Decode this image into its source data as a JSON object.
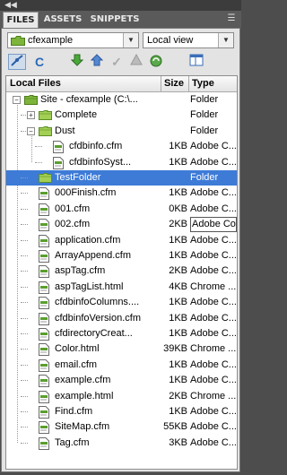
{
  "window": {
    "collapse_glyph": "◀◀"
  },
  "tabs": [
    {
      "label": "FILES",
      "active": true
    },
    {
      "label": "ASSETS",
      "active": false
    },
    {
      "label": "SNIPPETS",
      "active": false
    }
  ],
  "panel_menu_icon": "panel-menu-icon",
  "site_select": {
    "value": "cfexample"
  },
  "view_select": {
    "value": "Local view"
  },
  "toolbar": [
    "connect-icon",
    "refresh-icon",
    "get-files-icon",
    "put-files-icon",
    "check-out-icon",
    "check-in-icon",
    "synchronize-icon",
    "expand-view-icon"
  ],
  "columns": {
    "name": "Local Files",
    "size": "Size",
    "type": "Type"
  },
  "tree": [
    {
      "name": "Site - cfexample (C:\\...",
      "size": "",
      "type": "Folder",
      "kind": "site",
      "level": 0,
      "expander": "−"
    },
    {
      "name": "Complete",
      "size": "",
      "type": "Folder",
      "kind": "folder",
      "level": 1,
      "expander": "+"
    },
    {
      "name": "Dust",
      "size": "",
      "type": "Folder",
      "kind": "folder",
      "level": 1,
      "expander": "−"
    },
    {
      "name": "cfdbinfo.cfm",
      "size": "1KB",
      "type": "Adobe C...",
      "kind": "file",
      "level": 2
    },
    {
      "name": "cfdbinfoSyst...",
      "size": "1KB",
      "type": "Adobe C...",
      "kind": "file",
      "level": 2
    },
    {
      "name": "TestFolder",
      "size": "",
      "type": "Folder",
      "kind": "folder",
      "level": 1,
      "selected": true
    },
    {
      "name": "000Finish.cfm",
      "size": "1KB",
      "type": "Adobe C...",
      "kind": "file",
      "level": 1
    },
    {
      "name": "001.cfm",
      "size": "0KB",
      "type": "Adobe C...",
      "kind": "file",
      "level": 1
    },
    {
      "name": "002.cfm",
      "size": "2KB",
      "type": "Adobe Cold",
      "kind": "file",
      "level": 1,
      "boxed": true
    },
    {
      "name": "application.cfm",
      "size": "1KB",
      "type": "Adobe C...",
      "kind": "file",
      "level": 1
    },
    {
      "name": "ArrayAppend.cfm",
      "size": "1KB",
      "type": "Adobe C...",
      "kind": "file",
      "level": 1
    },
    {
      "name": "aspTag.cfm",
      "size": "2KB",
      "type": "Adobe C...",
      "kind": "file",
      "level": 1
    },
    {
      "name": "aspTagList.html",
      "size": "4KB",
      "type": "Chrome ...",
      "kind": "file",
      "level": 1
    },
    {
      "name": "cfdbinfoColumns....",
      "size": "1KB",
      "type": "Adobe C...",
      "kind": "file",
      "level": 1
    },
    {
      "name": "cfdbinfoVersion.cfm",
      "size": "1KB",
      "type": "Adobe C...",
      "kind": "file",
      "level": 1
    },
    {
      "name": "cfdirectoryCreat...",
      "size": "1KB",
      "type": "Adobe C...",
      "kind": "file",
      "level": 1
    },
    {
      "name": "Color.html",
      "size": "39KB",
      "type": "Chrome ...",
      "kind": "file",
      "level": 1
    },
    {
      "name": "email.cfm",
      "size": "1KB",
      "type": "Adobe C...",
      "kind": "file",
      "level": 1
    },
    {
      "name": "example.cfm",
      "size": "1KB",
      "type": "Adobe C...",
      "kind": "file",
      "level": 1
    },
    {
      "name": "example.html",
      "size": "2KB",
      "type": "Chrome ...",
      "kind": "file",
      "level": 1
    },
    {
      "name": "Find.cfm",
      "size": "1KB",
      "type": "Adobe C...",
      "kind": "file",
      "level": 1
    },
    {
      "name": "SiteMap.cfm",
      "size": "55KB",
      "type": "Adobe C...",
      "kind": "file",
      "level": 1
    },
    {
      "name": "Tag.cfm",
      "size": "3KB",
      "type": "Adobe C...",
      "kind": "file",
      "level": 1
    }
  ]
}
